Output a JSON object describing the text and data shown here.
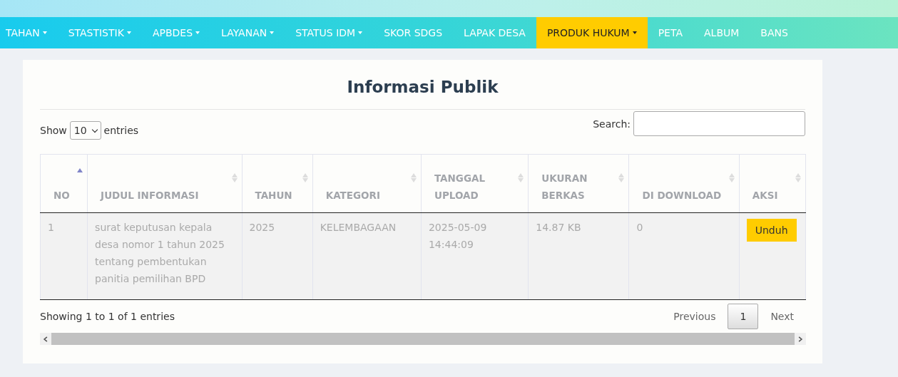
{
  "nav": [
    {
      "label": "TAHAN",
      "dropdown": true,
      "selected": false
    },
    {
      "label": "STASTISTIK",
      "dropdown": true,
      "selected": false
    },
    {
      "label": "APBDES",
      "dropdown": true,
      "selected": false
    },
    {
      "label": "LAYANAN",
      "dropdown": true,
      "selected": false
    },
    {
      "label": "STATUS IDM",
      "dropdown": true,
      "selected": false
    },
    {
      "label": "SKOR SDGS",
      "dropdown": false,
      "selected": false
    },
    {
      "label": "LAPAK DESA",
      "dropdown": false,
      "selected": false
    },
    {
      "label": "PRODUK HUKUM",
      "dropdown": true,
      "selected": true
    },
    {
      "label": "PETA",
      "dropdown": false,
      "selected": false
    },
    {
      "label": "ALBUM",
      "dropdown": false,
      "selected": false
    },
    {
      "label": "BANS",
      "dropdown": false,
      "selected": false
    }
  ],
  "title": "Informasi Publik",
  "length": {
    "before": "Show",
    "value": "10",
    "after": "entries"
  },
  "search": {
    "label": "Search:"
  },
  "table": {
    "columns": [
      {
        "label": "NO",
        "sorted": true
      },
      {
        "label": "JUDUL INFORMASI",
        "sorted": false
      },
      {
        "label": "TAHUN",
        "sorted": false
      },
      {
        "label": "KATEGORI",
        "sorted": false
      },
      {
        "label": "TANGGAL UPLOAD",
        "sorted": false
      },
      {
        "label": "UKURAN BERKAS",
        "sorted": false
      },
      {
        "label": "DI DOWNLOAD",
        "sorted": false
      },
      {
        "label": "AKSI",
        "sorted": false
      }
    ],
    "rows": [
      {
        "cells": [
          "1",
          "surat keputusan kepala desa nomor 1 tahun 2025 tentang pembentukan panitia pemilihan BPD",
          "2025",
          "KELEMBAGAAN",
          "2025-05-09 14:44:09",
          "14.87 KB",
          "0"
        ],
        "action": "Unduh"
      }
    ]
  },
  "info": "Showing 1 to 1 of 1 entries",
  "pagination": [
    {
      "label": "Previous",
      "selected": false
    },
    {
      "label": "1",
      "selected": true
    },
    {
      "label": "Next",
      "selected": false
    }
  ]
}
